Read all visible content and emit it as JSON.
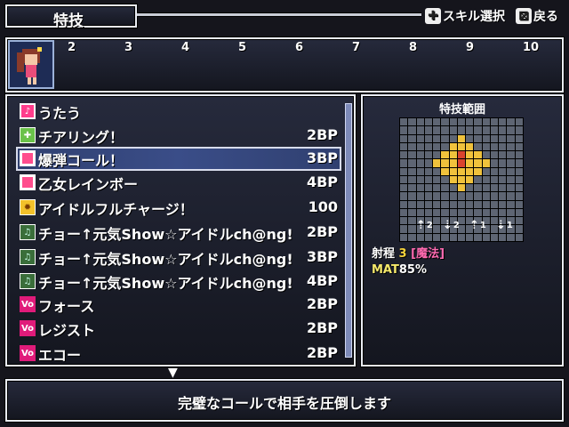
{
  "header": {
    "title": "特技",
    "hint_skill_select": "スキル選択",
    "hint_back": "戻る",
    "hint_skill_icon": "dpad-icon",
    "hint_back_icon": "x-button-icon"
  },
  "party": {
    "slots": [
      "2",
      "3",
      "4",
      "5",
      "6",
      "7",
      "8",
      "9",
      "10"
    ]
  },
  "skills": [
    {
      "name": "うたう",
      "cost": "",
      "icon": "song-icon"
    },
    {
      "name": "チアリング！",
      "cost": "2BP",
      "icon": "cheer-plus-icon"
    },
    {
      "name": "爆弾コール！",
      "cost": "3BP",
      "icon": "pink-square-icon",
      "selected": true
    },
    {
      "name": "乙女レインボー",
      "cost": "4BP",
      "icon": "pink-square-icon"
    },
    {
      "name": "アイドルフルチャージ！",
      "cost": "100",
      "icon": "star-burst-icon"
    },
    {
      "name": "チョー↑元気Show☆アイドルch@ng!",
      "cost": "2BP",
      "icon": "music-note-icon"
    },
    {
      "name": "チョー↑元気Show☆アイドルch@ng!",
      "cost": "3BP",
      "icon": "music-note-icon"
    },
    {
      "name": "チョー↑元気Show☆アイドルch@ng!",
      "cost": "4BP",
      "icon": "music-note-icon"
    },
    {
      "name": "フォース",
      "cost": "2BP",
      "icon": "vo-icon"
    },
    {
      "name": "レジスト",
      "cost": "2BP",
      "icon": "vo-icon"
    },
    {
      "name": "エコー",
      "cost": "2BP",
      "icon": "vo-icon"
    }
  ],
  "range": {
    "title": "特技範囲",
    "directions": [
      {
        "arrow": "up",
        "value": "2"
      },
      {
        "arrow": "down",
        "value": "2"
      },
      {
        "arrow": "up",
        "value": "1"
      },
      {
        "arrow": "down",
        "value": "1"
      }
    ],
    "range_label": "射程",
    "range_value": "3",
    "attack_type": "[魔法]",
    "mat_label": "MAT",
    "mat_value": "85%"
  },
  "description": "完璧なコールで相手を圧倒します",
  "colors": {
    "accent_yellow": "#f0c23c",
    "center_red": "#d9442e",
    "magic_pink": "#ff6ab0"
  }
}
